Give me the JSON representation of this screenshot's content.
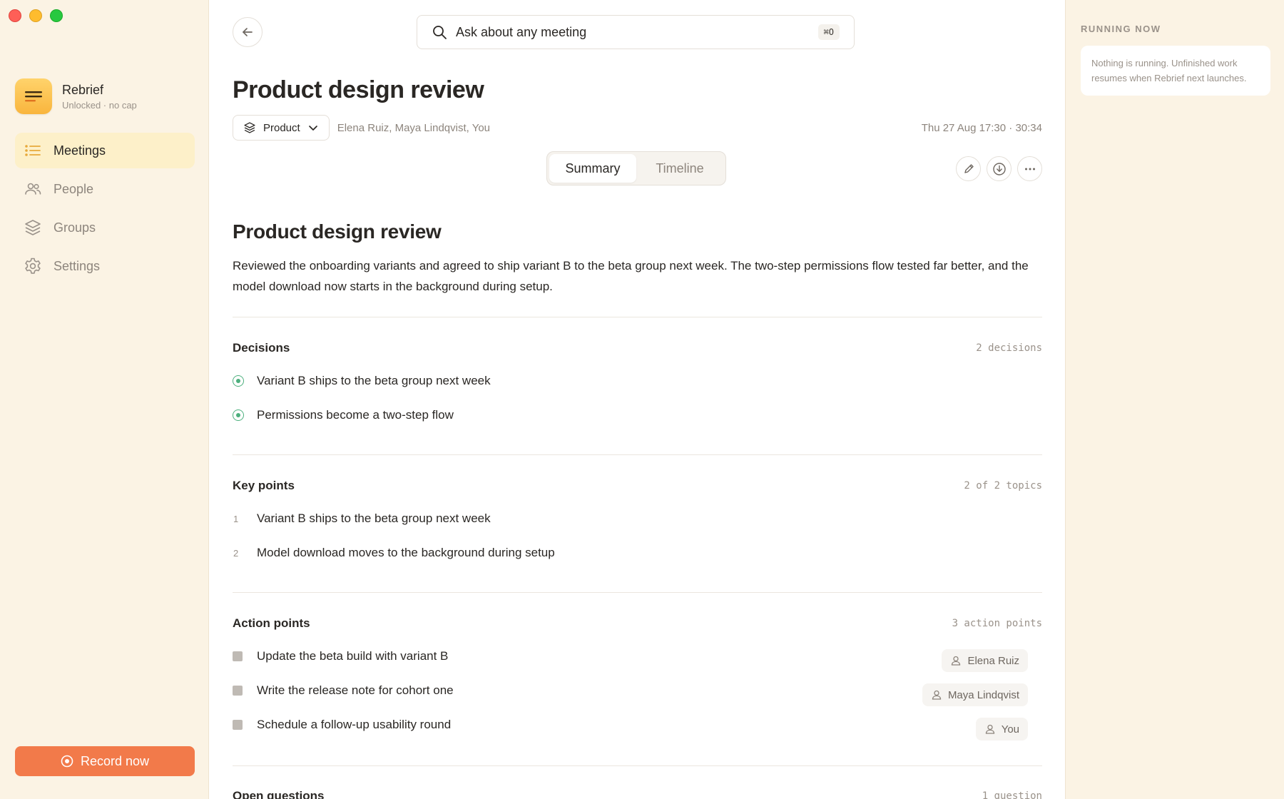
{
  "sidebar": {
    "brand": {
      "name": "Rebrief",
      "subtitle": "Unlocked · no cap"
    },
    "items": [
      {
        "label": "Meetings",
        "icon": "list-icon",
        "active": true
      },
      {
        "label": "People",
        "icon": "people-icon"
      },
      {
        "label": "Groups",
        "icon": "layers-icon"
      },
      {
        "label": "Settings",
        "icon": "gear-icon"
      }
    ],
    "record_label": "Record now"
  },
  "main": {
    "search": {
      "placeholder": "Ask about any meeting",
      "shortcut": "⌘O"
    },
    "title": "Product design review",
    "group": "Product",
    "participants": "Elena Ruiz, Maya Lindqvist, You",
    "datetime": "Thu 27 Aug 17:30 · 30:34",
    "tabs": [
      {
        "label": "Summary",
        "active": true
      },
      {
        "label": "Timeline",
        "active": false
      }
    ],
    "summary": {
      "title": "Product design review",
      "text": "Reviewed the onboarding variants and agreed to ship variant B to the beta group next week. The two-step permissions flow tested far better, and the model download now starts in the background during setup."
    },
    "decisions": {
      "heading": "Decisions",
      "count": "2 decisions",
      "items": [
        "Variant B ships to the beta group next week",
        "Permissions become a two-step flow"
      ]
    },
    "key_points": {
      "heading": "Key points",
      "count": "2 of 2 topics",
      "items": [
        {
          "num": "1",
          "text": "Variant B ships to the beta group next week"
        },
        {
          "num": "2",
          "text": "Model download moves to the background during setup"
        }
      ]
    },
    "action_points": {
      "heading": "Action points",
      "count": "3 action points",
      "items": [
        {
          "text": "Update the beta build with variant B",
          "assignee": "Elena Ruiz"
        },
        {
          "text": "Write the release note for cohort one",
          "assignee": "Maya Lindqvist"
        },
        {
          "text": "Schedule a follow-up usability round",
          "assignee": "You"
        }
      ]
    },
    "open_questions": {
      "heading": "Open questions",
      "count": "1 question"
    }
  },
  "right_panel": {
    "label": "RUNNING NOW",
    "message": "Nothing is running. Unfinished work resumes when Rebrief next launches."
  },
  "colors": {
    "accent": "#f27a4a",
    "decision_green": "#4caf7d",
    "sidebar_bg": "#fbf3e4",
    "nav_active_bg": "#fdf0c9"
  }
}
